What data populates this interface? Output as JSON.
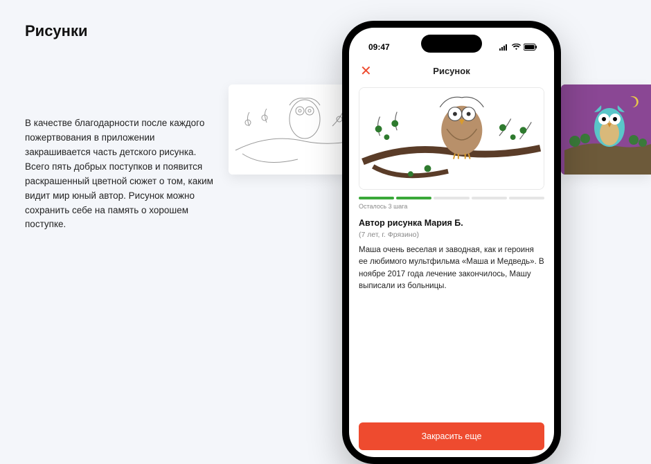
{
  "left": {
    "title": "Рисунки",
    "description": "В качестве благодарности после каждого пожертвования в приложении закрашивается часть детского рисунка. Всего пять добрых поступков и появится раскрашенный цветной сюжет о том, каким видит мир юный автор. Рисунок можно сохранить себе на память о хорошем поступке."
  },
  "phone": {
    "status": {
      "time": "09:47",
      "signal_icon": "signal",
      "wifi_icon": "wifi",
      "battery_icon": "battery"
    },
    "nav": {
      "close_label": "✕",
      "title": "Рисунок"
    },
    "drawing": {
      "alt": "owl-on-branch-partial-color"
    },
    "progress": {
      "done": 2,
      "total": 5,
      "label": "Осталось 3 шага"
    },
    "author": {
      "title": "Автор рисунка Мария Б.",
      "meta": "(7 лет, г. Фрязино)",
      "desc": "Маша очень веселая и заводная, как и героиня ее любимого мультфильма «Маша и Медведь». В ноябре 2017 года лечение закончилось, Машу выписали из больницы."
    },
    "cta": "Закрасить еще"
  },
  "thumbs": {
    "left_alt": "owl-outline-sketch",
    "right_alt": "owl-painted-night"
  }
}
